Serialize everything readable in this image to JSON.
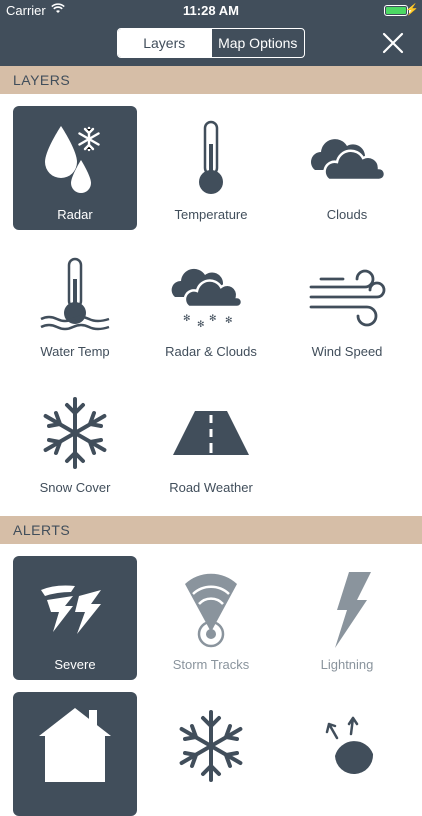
{
  "status_bar": {
    "carrier": "Carrier",
    "time": "11:28 AM",
    "battery_color": "#4cd964"
  },
  "header": {
    "tabs": [
      {
        "label": "Layers",
        "active": true
      },
      {
        "label": "Map Options",
        "active": false
      }
    ],
    "close_icon": "close-icon"
  },
  "colors": {
    "header_bg": "#414e5b",
    "section_bg": "#d6bea7",
    "selected_tile": "#414e5b",
    "icon": "#414e5b",
    "icon_dim": "#8a949d"
  },
  "layers": {
    "title": "LAYERS",
    "items": [
      {
        "label": "Radar",
        "icon": "radar-icon",
        "selected": true
      },
      {
        "label": "Temperature",
        "icon": "thermometer-icon",
        "selected": false
      },
      {
        "label": "Clouds",
        "icon": "clouds-icon",
        "selected": false
      },
      {
        "label": "Water Temp",
        "icon": "water-temp-icon",
        "selected": false
      },
      {
        "label": "Radar & Clouds",
        "icon": "radar-clouds-icon",
        "selected": false
      },
      {
        "label": "Wind Speed",
        "icon": "wind-icon",
        "selected": false
      },
      {
        "label": "Snow Cover",
        "icon": "snowflake-icon",
        "selected": false
      },
      {
        "label": "Road Weather",
        "icon": "road-icon",
        "selected": false
      }
    ]
  },
  "alerts": {
    "title": "ALERTS",
    "items": [
      {
        "label": "Severe",
        "icon": "severe-icon",
        "selected": true
      },
      {
        "label": "Storm Tracks",
        "icon": "storm-tracks-icon",
        "selected": false
      },
      {
        "label": "Lightning",
        "icon": "lightning-icon",
        "selected": false
      },
      {
        "label": "",
        "icon": "house-icon",
        "selected": true
      },
      {
        "label": "",
        "icon": "snowflake-icon",
        "selected": false
      },
      {
        "label": "",
        "icon": "tropical-icon",
        "selected": false
      }
    ]
  }
}
